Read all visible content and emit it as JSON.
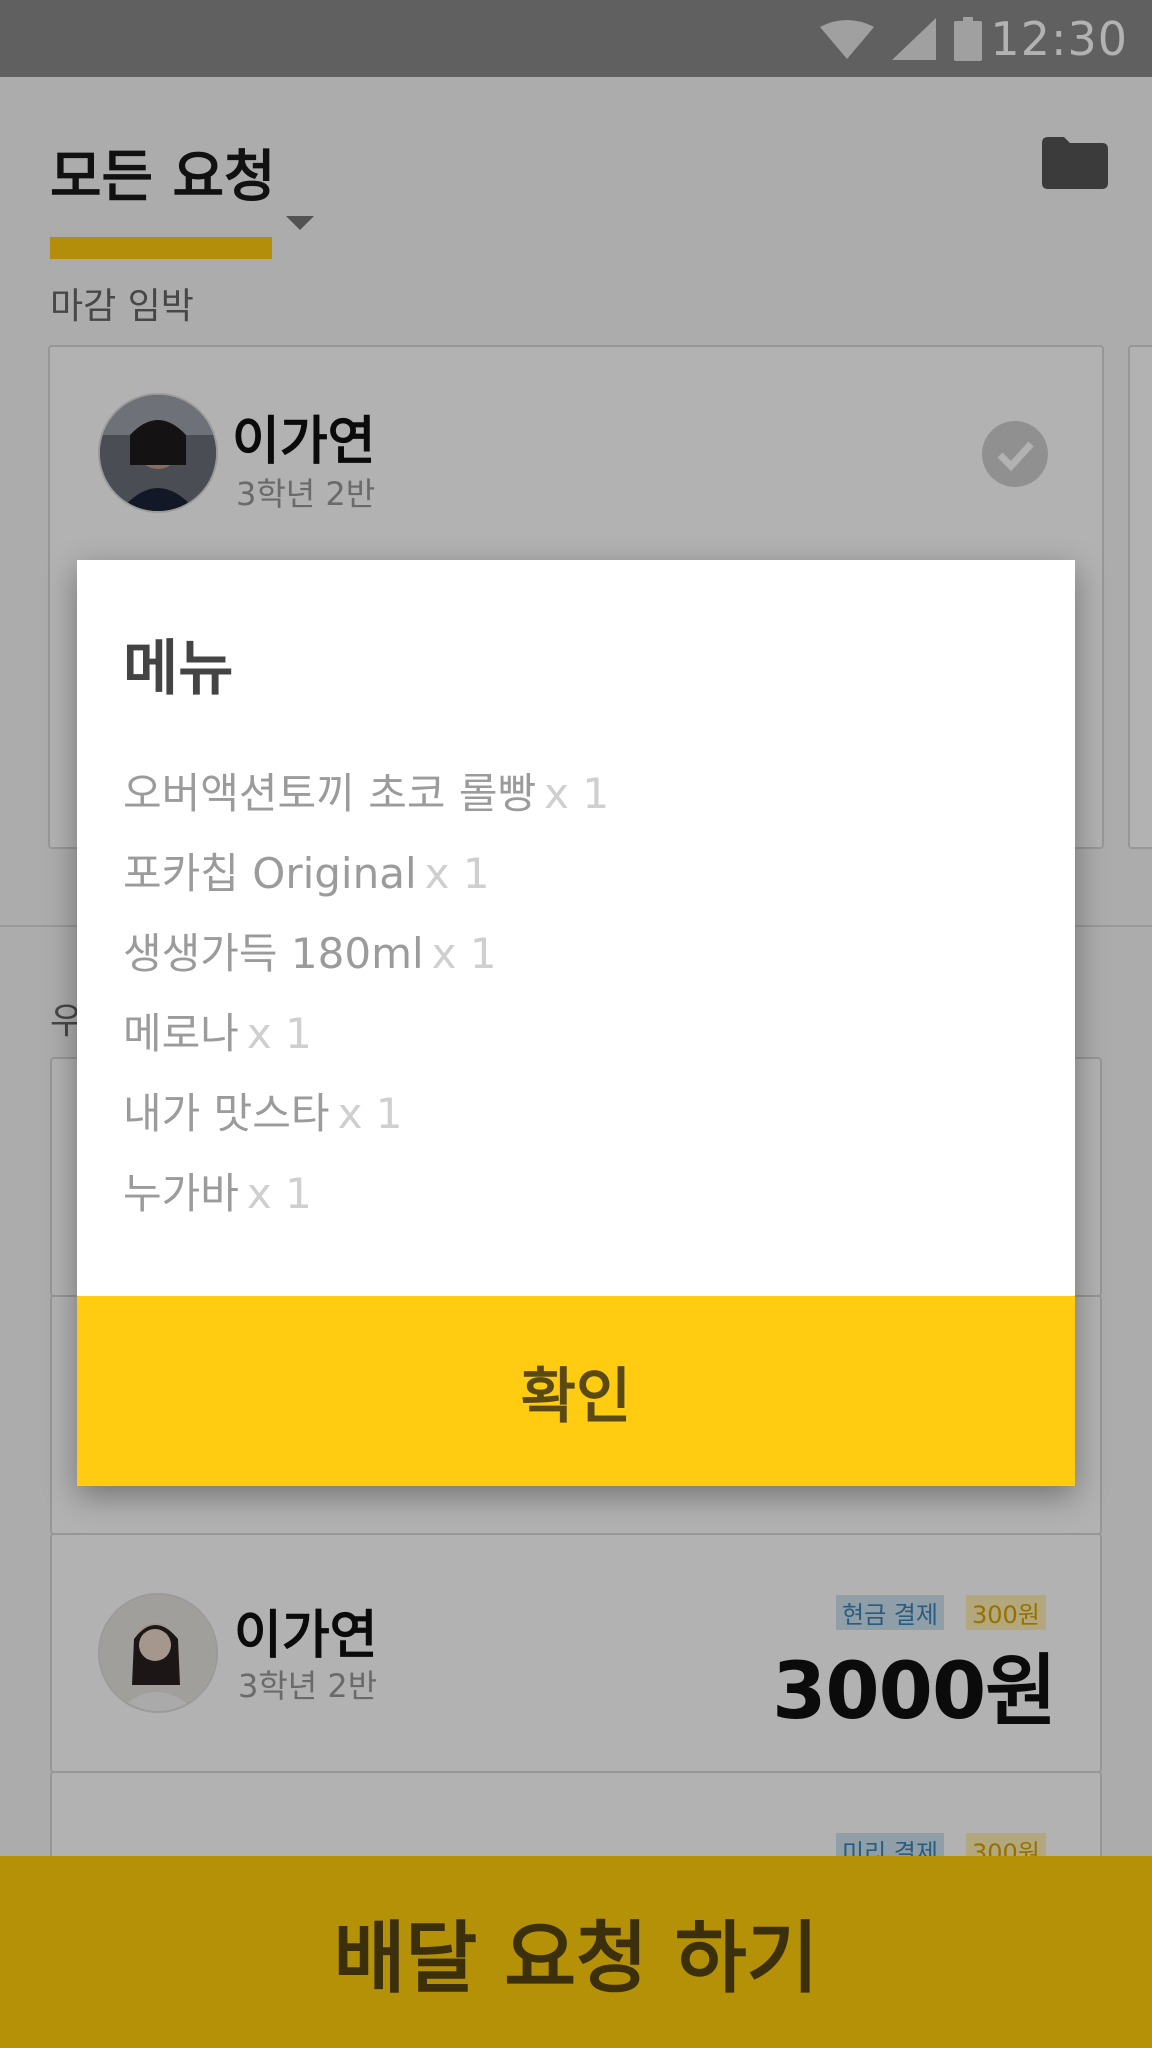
{
  "status_bar": {
    "time": "12:30",
    "icons": [
      "wifi-icon",
      "signal-icon",
      "battery-icon"
    ]
  },
  "header": {
    "title": "모든 요청",
    "folder_icon": "folder-icon"
  },
  "sections": {
    "deadline": "마감 임박",
    "other_partial": "우"
  },
  "deadline_card": {
    "name": "이가연",
    "grade": "3학년 2반"
  },
  "list_card": {
    "name": "이가연",
    "grade": "3학년 2반",
    "payment_method": "현금 결제",
    "fee": "300원",
    "price": "3000원"
  },
  "list_card_partial": {
    "payment_method": "미리 결제",
    "fee": "300원"
  },
  "dialog": {
    "title": "메뉴",
    "items": [
      {
        "name": "오버액션토끼 초코 롤빵",
        "qty": "x 1"
      },
      {
        "name": "포카칩 Original",
        "qty": "x 1"
      },
      {
        "name": "생생가득 180ml",
        "qty": "x 1"
      },
      {
        "name": "메로나",
        "qty": "x 1"
      },
      {
        "name": "내가 맛스타",
        "qty": "x 1"
      },
      {
        "name": "누가바",
        "qty": "x 1"
      }
    ],
    "confirm_label": "확인"
  },
  "bottom_button": {
    "label": "배달 요청 하기"
  },
  "colors": {
    "accent": "#ffcc11",
    "status_bar": "#8a8a8a",
    "tag_blue": "#3a85b8",
    "tag_yellow": "#d7a200"
  }
}
